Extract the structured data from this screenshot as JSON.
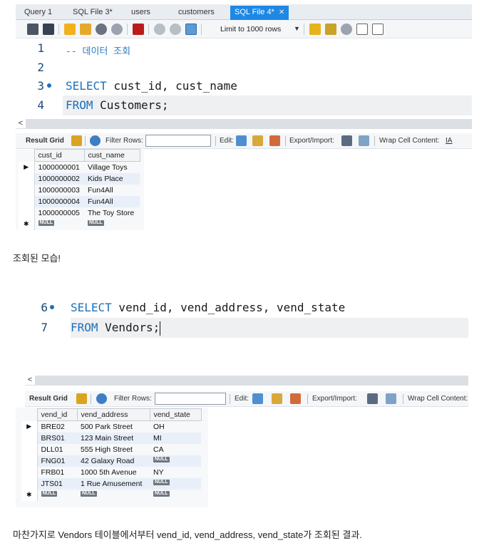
{
  "tabs": [
    {
      "label": "Query 1"
    },
    {
      "label": "SQL File 3*"
    },
    {
      "label": "users"
    },
    {
      "label": "customers"
    },
    {
      "label": "SQL File 4*",
      "active": true
    }
  ],
  "toolbar": {
    "limit_label": "Limit to 1000 rows"
  },
  "editor1": {
    "lines": [
      {
        "n": "1",
        "comment": "-- 데이터 조회"
      },
      {
        "n": "2"
      },
      {
        "n": "3",
        "kw": "SELECT",
        "rest": " cust_id, cust_name"
      },
      {
        "n": "4",
        "kw": "FROM",
        "rest": " Customers;"
      }
    ]
  },
  "resultbar": {
    "result_grid": "Result Grid",
    "filter_rows": "Filter Rows:",
    "edit": "Edit:",
    "export_import": "Export/Import:",
    "wrap": "Wrap Cell Content:"
  },
  "grid1": {
    "columns": [
      "cust_id",
      "cust_name"
    ],
    "rows": [
      [
        "1000000001",
        "Village Toys"
      ],
      [
        "1000000002",
        "Kids Place"
      ],
      [
        "1000000003",
        "Fun4All"
      ],
      [
        "1000000004",
        "Fun4All"
      ],
      [
        "1000000005",
        "The Toy Store"
      ]
    ]
  },
  "null_label": "NULL",
  "caption1": "조회된 모습!",
  "editor2": {
    "lines": [
      {
        "n": "6",
        "kw": "SELECT",
        "rest": " vend_id, vend_address, vend_state"
      },
      {
        "n": "7",
        "kw": "FROM",
        "rest": " Vendors;"
      }
    ]
  },
  "grid2": {
    "columns": [
      "vend_id",
      "vend_address",
      "vend_state"
    ],
    "rows": [
      [
        "BRE02",
        "500 Park Street",
        "OH"
      ],
      [
        "BRS01",
        "123 Main Street",
        "MI"
      ],
      [
        "DLL01",
        "555 High Street",
        "CA"
      ],
      [
        "FNG01",
        "42 Galaxy Road",
        null
      ],
      [
        "FRB01",
        "1000 5th Avenue",
        "NY"
      ],
      [
        "JTS01",
        "1 Rue Amusement",
        null
      ]
    ]
  },
  "caption2": "마찬가지로 Vendors 테이블에서부터 vend_id, vend_address, vend_state가 조회된 결과.",
  "colors": {
    "tab_active": "#1e88e5",
    "keyword": "#1e6fb8",
    "line_number": "#1b4b78"
  }
}
